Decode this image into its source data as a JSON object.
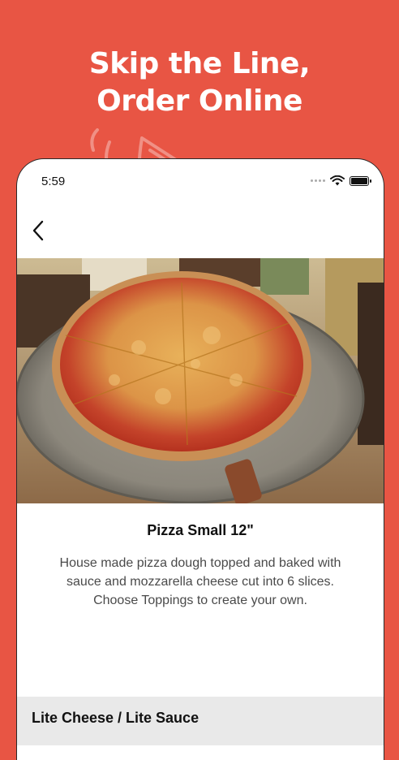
{
  "promo": {
    "headline_line1": "Skip the Line,",
    "headline_line2": "Order Online"
  },
  "status_bar": {
    "time": "5:59"
  },
  "item": {
    "title": "Pizza Small 12\"",
    "description": "House made pizza dough topped and baked with sauce and mozzarella cheese cut into 6 slices. Choose Toppings to create your own."
  },
  "options": {
    "first_group_label": "Lite Cheese / Lite Sauce"
  },
  "icons": {
    "back": "chevron-left-icon",
    "wifi": "wifi-icon",
    "battery": "battery-icon",
    "signal": "signal-icon",
    "decor": "pizza-slice-icon"
  },
  "colors": {
    "brand_background": "#E85544",
    "option_row_background": "#E9E9E9"
  }
}
